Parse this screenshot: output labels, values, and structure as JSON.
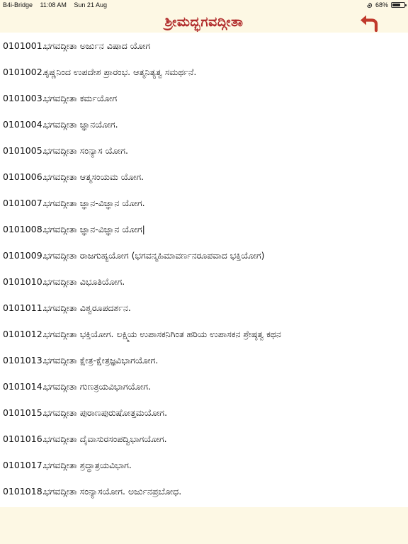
{
  "status_bar": {
    "carrier": "B4i-Bridge",
    "time": "11:08 AM",
    "date": "Sun 21 Aug",
    "battery_percent": "68%",
    "battery_level": 0.68
  },
  "header": {
    "title": "ಶ್ರೀಮದ್ಭಗವದ್ಗೀತಾ"
  },
  "items": [
    {
      "code": "0101001.",
      "title": "ಭಗವದ್ಗೀತಾ ಅರ್ಜುನ ವಿಷಾದ ಯೋಗ"
    },
    {
      "code": "0101002.",
      "title": "ಕೃಷ್ಣನಿಂದ ಉಪದೇಶ ಪ್ರಾರಂಭ. ಆತ್ಮನಿತ್ಯತ್ವ ಸಮರ್ಥನೆ."
    },
    {
      "code": "0101003.",
      "title": "ಭಗವದ್ಗೀತಾ ಕರ್ಮಯೋಗ"
    },
    {
      "code": "0101004.",
      "title": "ಭಗವದ್ಗೀತಾ ಜ್ಞಾನಯೋಗ."
    },
    {
      "code": "0101005.",
      "title": "ಭಗವದ್ಗೀತಾ ಸಂನ್ಯಾಸ ಯೋಗ."
    },
    {
      "code": "0101006.",
      "title": "ಭಗವದ್ಗೀತಾ ಆತ್ಮಸಂಯಮ ಯೋಗ."
    },
    {
      "code": "0101007.",
      "title": "ಭಗವದ್ಗೀತಾ ಜ್ಞಾನ-ವಿಜ್ಞಾನ ಯೋಗ."
    },
    {
      "code": "0101008.",
      "title": "ಭಗವದ್ಗೀತಾ ಜ್ಞಾನ-ವಿಜ್ಞಾನ ಯೋಗ|"
    },
    {
      "code": "0101009.",
      "title": "ಭಗವದ್ಗೀತಾ ರಾಜಗುಹ್ಯಯೋಗ (ಭಗವನ್ಮಹಿಮಾವರ್ಣನರೂಪವಾದ ಭಕ್ತಿಯೋಗ)"
    },
    {
      "code": "0101010.",
      "title": "ಭಗವದ್ಗೀತಾ ವಿಭೂತಿಯೋಗ."
    },
    {
      "code": "0101011.",
      "title": "ಭಗವದ್ಗೀತಾ ವಿಶ್ವರೂಪದರ್ಶನ."
    },
    {
      "code": "0101012.",
      "title": "ಭಗವದ್ಗೀತಾ ಭಕ್ತಿಯೋಗ. ಲಕ್ಷ್ಮಿಯ ಉಪಾಸಕನಿಗಿಂತ ಹರಿಯ ಉಪಾಸಕನ ಶ್ರೇಷ್ಠತ್ವ ಕಥನ"
    },
    {
      "code": "0101013.",
      "title": "ಭಗವದ್ಗೀತಾ ಕ್ಷೇತ್ರ-ಕ್ಷೇತ್ರಜ್ಞವಿಭಾಗಯೋಗ."
    },
    {
      "code": "0101014.",
      "title": "ಭಗವದ್ಗೀತಾ ಗುಣತ್ರಯವಿಭಾಗಯೋಗ."
    },
    {
      "code": "0101015.",
      "title": "ಭಗವದ್ಗೀತಾ ಪುರಾಣಪುರುಷೋತ್ತಮಯೋಗ."
    },
    {
      "code": "0101016.",
      "title": "ಭಗವದ್ಗೀತಾ ದೈವಾಸುರಸಂಪದ್ವಿಭಾಗಯೋಗ."
    },
    {
      "code": "0101017.",
      "title": "ಭಗವದ್ಗೀತಾ ಶ್ರದ್ಧಾತ್ರಯವಿಭಾಗ."
    },
    {
      "code": "0101018.",
      "title": "ಭಗವದ್ಗೀತಾ ಸಂನ್ಯಾಸಯೋಗ. ಅರ್ಜುನಪ್ರಬೋಧ."
    }
  ],
  "icons": {
    "back": "back-arrow-icon",
    "orientation_lock": "orientation-lock-icon",
    "battery": "battery-icon"
  },
  "colors": {
    "title": "#b02a2a",
    "back_arrow": "#c0392b",
    "background": "#fdf8e4",
    "list_background": "#ffffff"
  }
}
